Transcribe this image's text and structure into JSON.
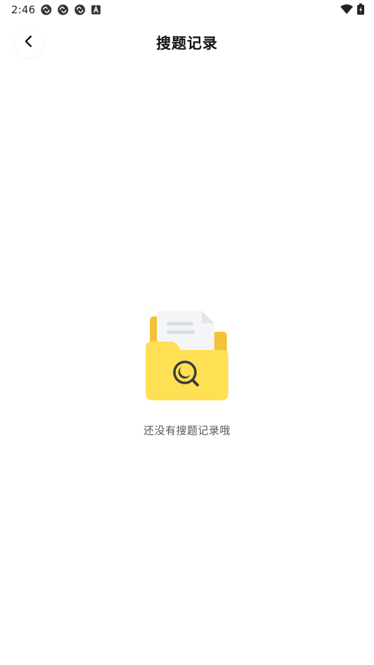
{
  "status_bar": {
    "time": "2:46",
    "notification_icons": [
      "sync-icon",
      "sync-icon",
      "sync-icon",
      "a-box-icon"
    ],
    "right_icons": [
      "wifi-icon",
      "battery-icon"
    ]
  },
  "header": {
    "back_icon": "chevron-left-icon",
    "title": "搜题记录"
  },
  "empty_state": {
    "illustration_icon": "folder-search-icon",
    "message": "还没有搜题记录哦"
  },
  "colors": {
    "folder_front": "#FFDF53",
    "folder_back": "#F2C23A",
    "paper": "#F4F5F7",
    "paper_lines": "#D9DCE0",
    "magnifier": "#3A3A3A",
    "text_secondary": "#555555"
  }
}
